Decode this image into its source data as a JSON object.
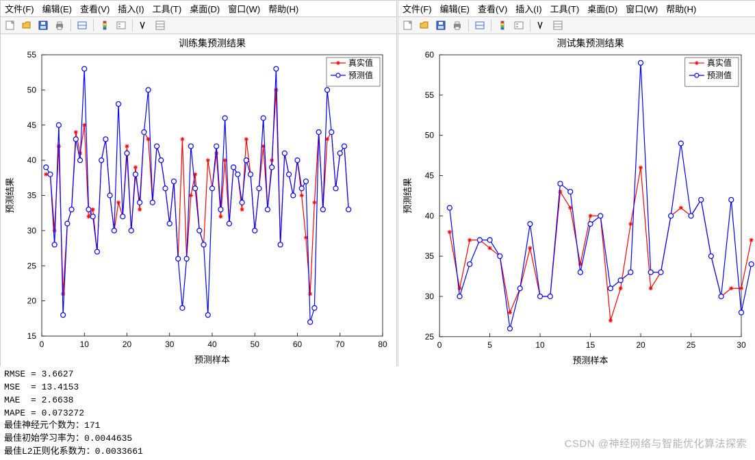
{
  "menus": {
    "file": "文件(F)",
    "edit": "编辑(E)",
    "view": "查看(V)",
    "insert": "插入(I)",
    "tools": "工具(T)",
    "desktop": "桌面(D)",
    "window": "窗口(W)",
    "help": "帮助(H)"
  },
  "chart_data": [
    {
      "type": "line",
      "title": "训练集预测结果",
      "xlabel": "预测样本",
      "ylabel": "预测结果",
      "xlim": [
        0,
        80
      ],
      "ylim": [
        15,
        55
      ],
      "xticks": [
        0,
        10,
        20,
        30,
        40,
        50,
        60,
        70,
        80
      ],
      "yticks": [
        15,
        20,
        25,
        30,
        35,
        40,
        45,
        50,
        55
      ],
      "legend": [
        "真实值",
        "预测值"
      ],
      "legend_colors": [
        "#ff0000",
        "#0000ff"
      ],
      "legend_markers": [
        "*",
        "o"
      ],
      "x": [
        1,
        2,
        3,
        4,
        5,
        6,
        7,
        8,
        9,
        10,
        11,
        12,
        13,
        14,
        15,
        16,
        17,
        18,
        19,
        20,
        21,
        22,
        23,
        24,
        25,
        26,
        27,
        28,
        29,
        30,
        31,
        32,
        33,
        34,
        35,
        36,
        37,
        38,
        39,
        40,
        41,
        42,
        43,
        44,
        45,
        46,
        47,
        48,
        49,
        50,
        51,
        52,
        53,
        54,
        55,
        56,
        57,
        58,
        59,
        60,
        61,
        62,
        63,
        64,
        65,
        66,
        67,
        68,
        69,
        70,
        71,
        72
      ],
      "series": [
        {
          "name": "真实值",
          "color": "#ff0000",
          "marker": "*",
          "y": [
            38,
            38,
            30,
            42,
            21,
            31,
            33,
            44,
            41,
            45,
            32,
            33,
            27,
            40,
            43,
            35,
            30,
            34,
            32,
            42,
            30,
            39,
            33,
            44,
            43,
            34,
            42,
            40,
            36,
            31,
            37,
            26,
            43,
            26,
            35,
            38,
            30,
            28,
            40,
            36,
            41,
            32,
            40,
            31,
            39,
            38,
            33,
            43,
            38,
            30,
            36,
            42,
            33,
            40,
            50,
            28,
            41,
            38,
            35,
            40,
            35,
            29,
            21,
            34,
            44,
            33,
            43,
            44,
            36,
            41,
            42,
            33
          ]
        },
        {
          "name": "预测值",
          "color": "#0000ff",
          "marker": "o",
          "y": [
            39,
            38,
            28,
            45,
            18,
            31,
            33,
            43,
            40,
            53,
            33,
            32,
            27,
            40,
            43,
            35,
            30,
            48,
            32,
            41,
            30,
            38,
            34,
            44,
            50,
            34,
            42,
            40,
            36,
            31,
            37,
            26,
            19,
            26,
            42,
            36,
            30,
            28,
            18,
            36,
            42,
            33,
            46,
            31,
            39,
            38,
            34,
            40,
            38,
            30,
            36,
            46,
            33,
            39,
            53,
            28,
            41,
            38,
            35,
            40,
            36,
            37,
            17,
            19,
            44,
            33,
            50,
            44,
            36,
            41,
            42,
            33
          ]
        }
      ]
    },
    {
      "type": "line",
      "title": "测试集预测结果",
      "xlabel": "预测样本",
      "ylabel": "预测结果",
      "xlim": [
        0,
        30
      ],
      "ylim": [
        25,
        60
      ],
      "xticks": [
        0,
        5,
        10,
        15,
        20,
        25,
        30
      ],
      "yticks": [
        25,
        30,
        35,
        40,
        45,
        50,
        55,
        60
      ],
      "legend": [
        "真实值",
        "预测值"
      ],
      "legend_colors": [
        "#ff0000",
        "#0000ff"
      ],
      "legend_markers": [
        "*",
        "o"
      ],
      "x": [
        1,
        2,
        3,
        4,
        5,
        6,
        7,
        8,
        9,
        10,
        11,
        12,
        13,
        14,
        15,
        16,
        17,
        18,
        19,
        20,
        21,
        22,
        23,
        24,
        25,
        26,
        27,
        28,
        29,
        30,
        31
      ],
      "series": [
        {
          "name": "真实值",
          "color": "#ff0000",
          "marker": "*",
          "y": [
            38,
            31,
            37,
            37,
            36,
            35,
            28,
            31,
            36,
            30,
            30,
            43,
            41,
            34,
            40,
            40,
            27,
            31,
            39,
            46,
            31,
            33,
            40,
            41,
            40,
            42,
            35,
            30,
            31,
            31,
            37
          ]
        },
        {
          "name": "预测值",
          "color": "#0000ff",
          "marker": "o",
          "y": [
            41,
            30,
            34,
            37,
            37,
            35,
            26,
            31,
            39,
            30,
            30,
            44,
            43,
            33,
            39,
            40,
            31,
            32,
            33,
            59,
            33,
            33,
            40,
            49,
            40,
            42,
            35,
            30,
            42,
            28,
            34
          ]
        }
      ]
    }
  ],
  "console": {
    "rmse_label": "RMSE",
    "rmse": "3.6627",
    "mse_label": "MSE",
    "mse": "13.4153",
    "mae_label": "MAE",
    "mae": "2.6638",
    "mape_label": "MAPE",
    "mape": "0.073272",
    "best_neurons_label": "最佳神经元个数为：",
    "best_neurons": "171",
    "best_lr_label": "最佳初始学习率为：",
    "best_lr": "0.0044635",
    "best_l2_label": "最佳L2正则化系数为：",
    "best_l2": "0.0033661"
  },
  "watermark": "CSDN @神经网络与智能优化算法探索"
}
